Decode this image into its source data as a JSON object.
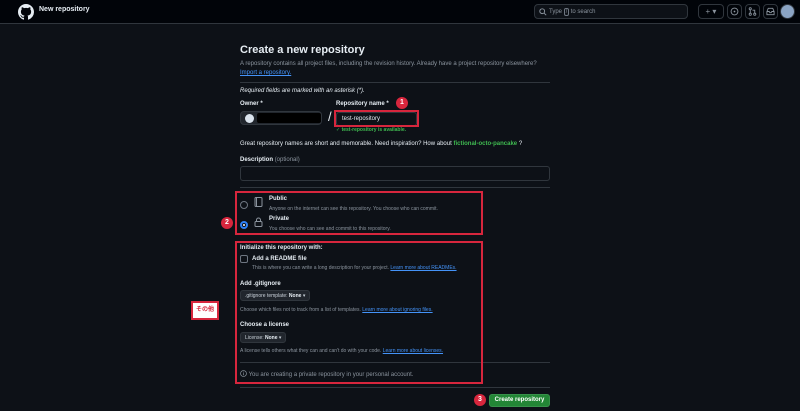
{
  "header": {
    "title": "New repository",
    "search_prefix": "Type",
    "search_key": "/",
    "search_suffix": "to search",
    "plus_label": "+ ▾"
  },
  "page": {
    "title": "Create a new repository",
    "subtitle": "A repository contains all project files, including the revision history. Already have a project repository elsewhere?",
    "import_link": "Import a repository.",
    "required_note": "Required fields are marked with an asterisk (*).",
    "owner_label": "Owner *",
    "slash": "/",
    "repo_label": "Repository name *",
    "repo_value": "test-repository",
    "available_msg": "✓ test-repository is available.",
    "hint_prefix": "Great repository names are short and memorable. Need inspiration? How about",
    "hint_suggestion": "fictional-octo-pancake",
    "hint_suffix": "?",
    "description_label": "Description",
    "description_optional": "(optional)",
    "description_value": ""
  },
  "visibility": {
    "public_title": "Public",
    "public_desc": "Anyone on the internet can see this repository. You choose who can commit.",
    "private_title": "Private",
    "private_desc": "You choose who can see and commit to this repository.",
    "selected": "private"
  },
  "init": {
    "title": "Initialize this repository with:",
    "readme_title": "Add a README file",
    "readme_desc": "This is where you can write a long description for your project.",
    "readme_link": "Learn more about READMEs.",
    "gitignore_title": "Add .gitignore",
    "gitignore_dd_label": ".gitignore template:",
    "gitignore_dd_value": "None",
    "gitignore_desc": "Choose which files not to track from a list of templates.",
    "gitignore_link": "Learn more about ignoring files.",
    "license_title": "Choose a license",
    "license_dd_label": "License:",
    "license_dd_value": "None",
    "license_desc": "A license tells others what they can and can't do with your code.",
    "license_link": "Learn more about licenses.",
    "notice": "You are creating a private repository in your personal account."
  },
  "actions": {
    "create_label": "Create repository"
  },
  "annotations": {
    "badge1": "1",
    "badge2": "2",
    "badge3": "3",
    "note": "その他"
  },
  "colors": {
    "background": "#0d1117",
    "primary_button": "#238636",
    "link": "#4493f8",
    "success": "#3fb950",
    "annotation": "#d7263d"
  }
}
